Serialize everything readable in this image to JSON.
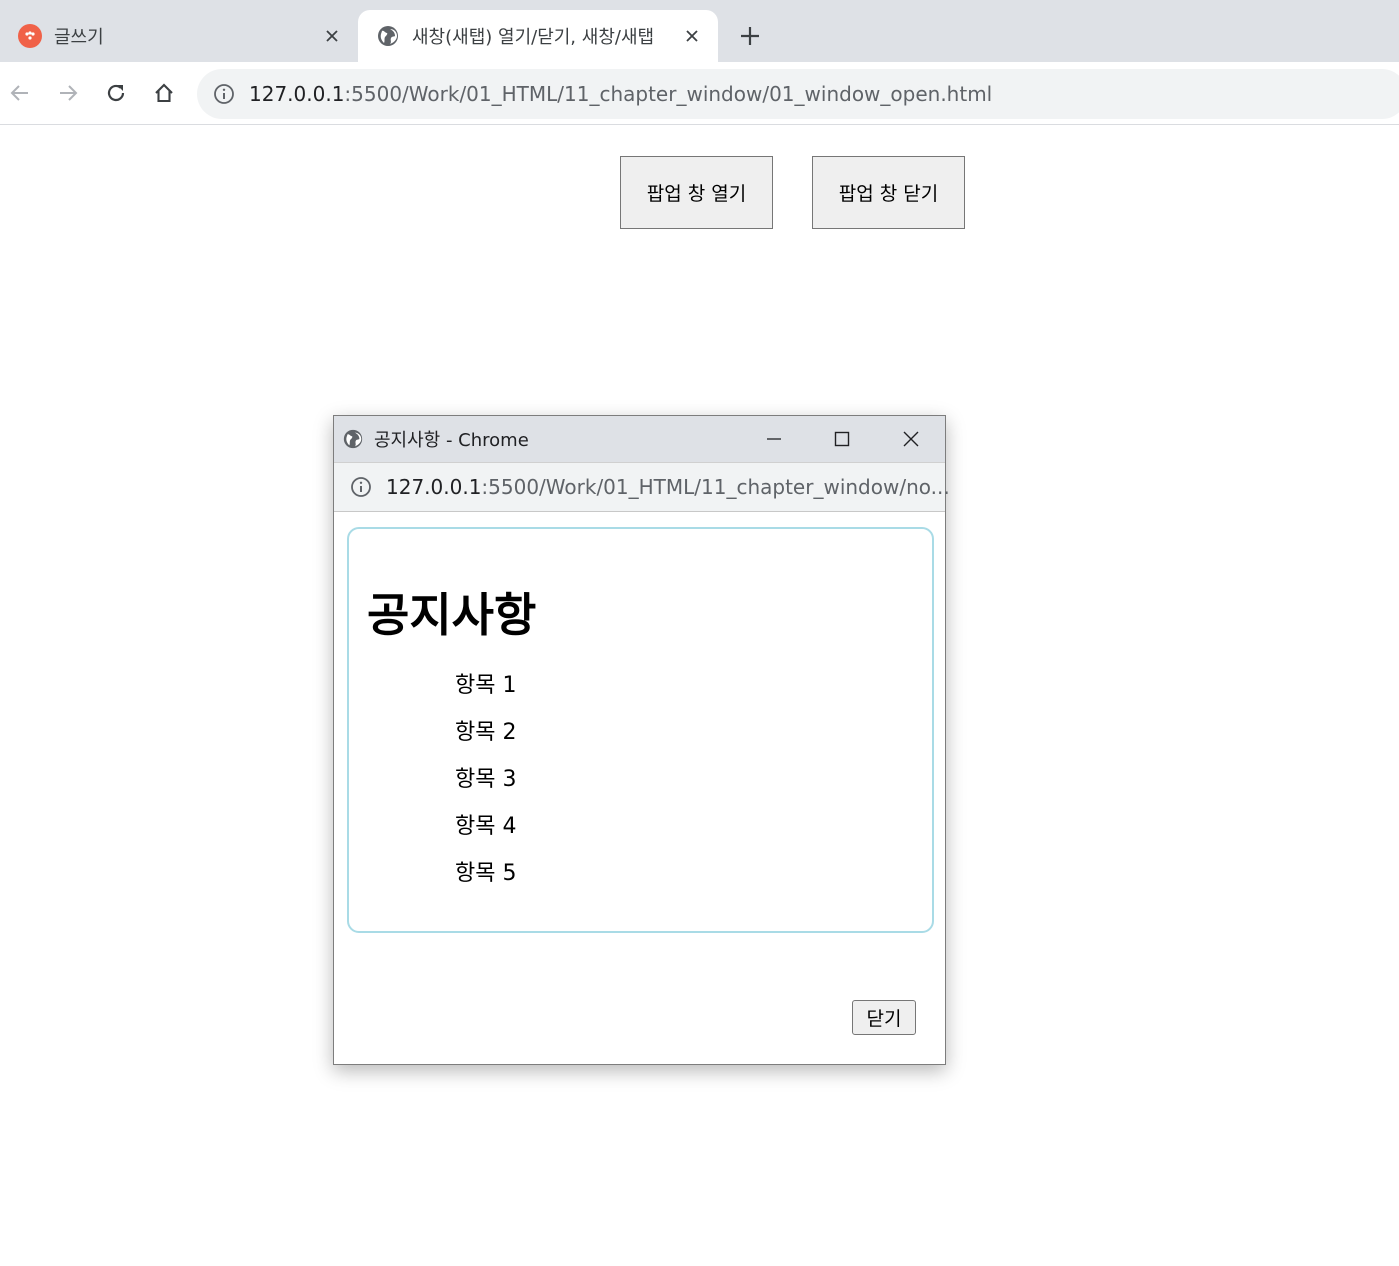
{
  "browser": {
    "tabs": [
      {
        "title": "글쓰기",
        "active": false,
        "icon": "daum-logo-icon"
      },
      {
        "title": "새창(새탭) 열기/닫기, 새창/새탭",
        "active": true,
        "icon": "globe-icon"
      }
    ],
    "url": {
      "host": "127.0.0.1",
      "path": ":5500/Work/01_HTML/11_chapter_window/01_window_open.html"
    }
  },
  "page": {
    "open_button_label": "팝업 창 열기",
    "close_button_label": "팝업 창 닫기"
  },
  "popup": {
    "window_title": "공지사항 - Chrome",
    "url": {
      "host": "127.0.0.1",
      "path": ":5500/Work/01_HTML/11_chapter_window/no..."
    },
    "heading": "공지사항",
    "items": [
      "항목 1",
      "항목 2",
      "항목 3",
      "항목 4",
      "항목 5"
    ],
    "close_label": "닫기"
  },
  "colors": {
    "tabstrip": "#dee1e6",
    "omnibox": "#f1f3f4",
    "notice_border": "#a9dbe6",
    "daum_icon": "#f06148"
  }
}
